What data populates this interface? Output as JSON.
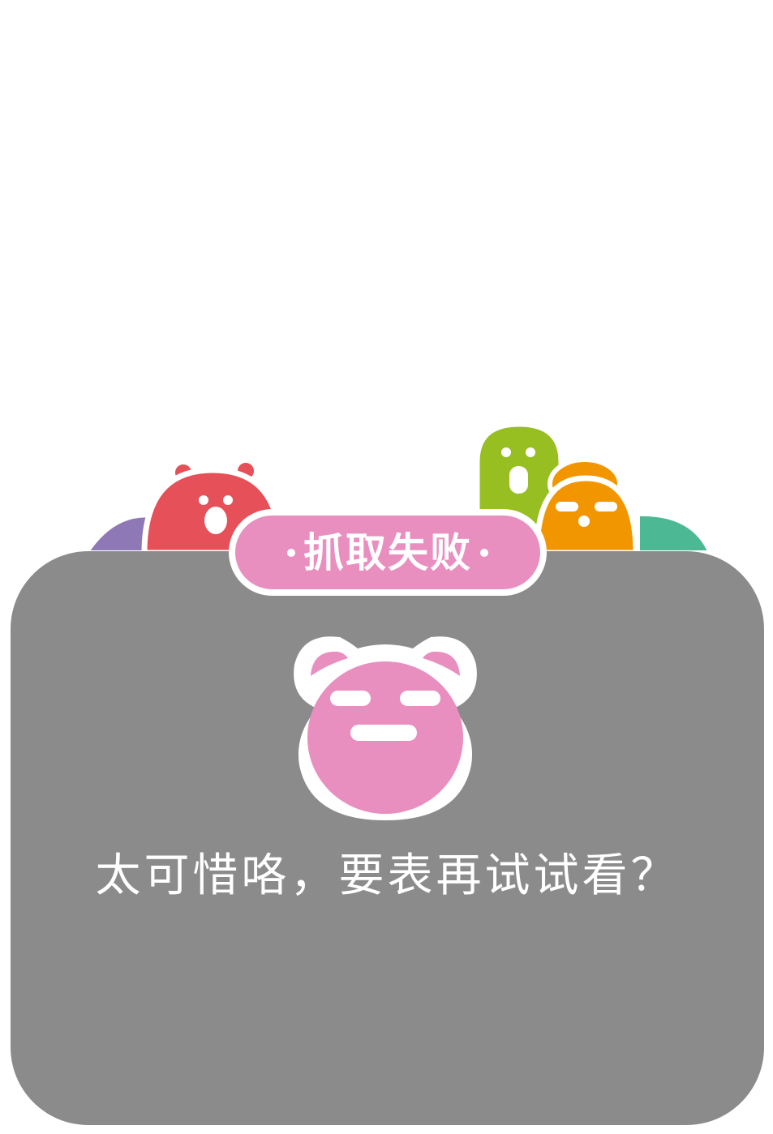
{
  "colors": {
    "panel_background": "#8b8b8b",
    "title_pill": "#e98fbf",
    "bear_pink": "#e98fbf",
    "red_creature": "#e65058",
    "green_creature": "#97bf22",
    "orange_creature": "#f29600",
    "purple_creature": "#8e78b5",
    "teal_creature": "#4db994",
    "text": "#ffffff"
  },
  "dialog": {
    "title": "抓取失败",
    "message": "太可惜咯，要表再试试看？"
  },
  "icons": {
    "title_dot": "dot-icon",
    "bear_face": "pink-bear-face-icon",
    "creatures": [
      "purple-creature-icon",
      "red-bear-creature-icon",
      "green-ghost-creature-icon",
      "orange-creature-icon",
      "teal-creature-icon"
    ]
  }
}
